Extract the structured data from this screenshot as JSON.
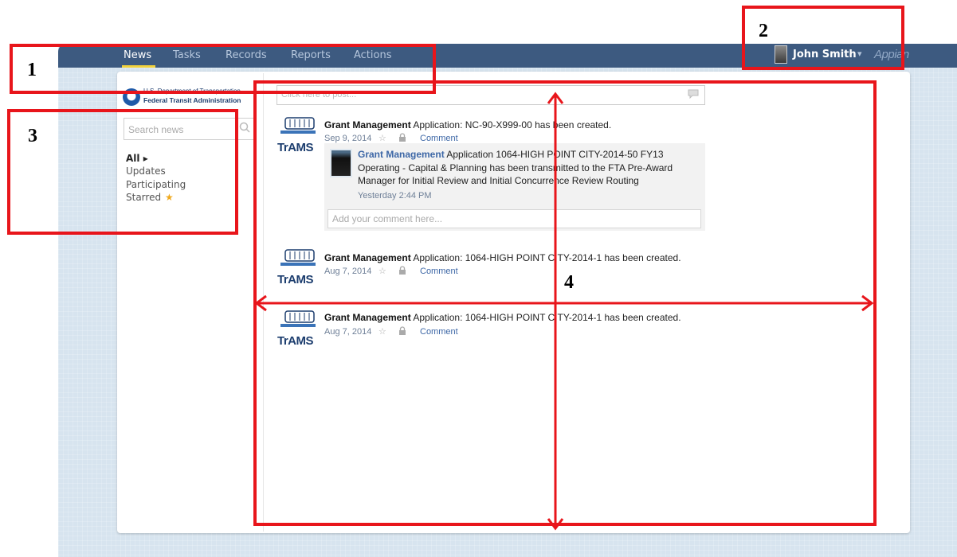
{
  "nav": {
    "tabs": [
      {
        "label": "News",
        "active": true
      },
      {
        "label": "Tasks",
        "active": false
      },
      {
        "label": "Records",
        "active": false
      },
      {
        "label": "Reports",
        "active": false
      },
      {
        "label": "Actions",
        "active": false
      }
    ],
    "user_name": "John Smith",
    "user_caret": "▾",
    "brand": "Appian"
  },
  "agency": {
    "line1": "U.S. Department of Transportation",
    "line2": "Federal Transit Administration"
  },
  "sidebar": {
    "search_placeholder": "Search news",
    "filters": [
      {
        "label": "All ▸",
        "active": true
      },
      {
        "label": "Updates",
        "active": false
      },
      {
        "label": "Participating",
        "active": false
      },
      {
        "label": "Starred",
        "active": false
      }
    ]
  },
  "feed": {
    "post_placeholder": "Click here to post...",
    "logo_word": "TrAMS",
    "items": [
      {
        "source": "Grant Management",
        "message": "Application: NC-90-X999-00 has been created.",
        "date": "Sep 9, 2014",
        "comment_label": "Comment"
      },
      {
        "source": "Grant Management",
        "message": "Application: 1064-HIGH POINT CITY-2014-1 has been created.",
        "date": "Aug 7, 2014",
        "comment_label": "Comment"
      },
      {
        "source": "Grant Management",
        "message": "Application: 1064-HIGH POINT CITY-2014-1 has been created.",
        "date": "Aug 7, 2014",
        "comment_label": "Comment"
      }
    ],
    "reply": {
      "source": "Grant Management",
      "message": "Application 1064-HIGH POINT CITY-2014-50 FY13 Operating - Capital & Planning has been transmitted to the FTA Pre-Award Manager for Initial Review and Initial Concurrence Review Routing",
      "time": "Yesterday 2:44 PM",
      "comment_placeholder": "Add your comment here..."
    }
  },
  "annotations": {
    "labels": [
      "1",
      "2",
      "3",
      "4"
    ],
    "color": "#e8151b"
  },
  "colors": {
    "topbar": "#3d5a80",
    "active_underline": "#f2d23c",
    "link": "#3d67a6",
    "star": "#f0a91e"
  }
}
